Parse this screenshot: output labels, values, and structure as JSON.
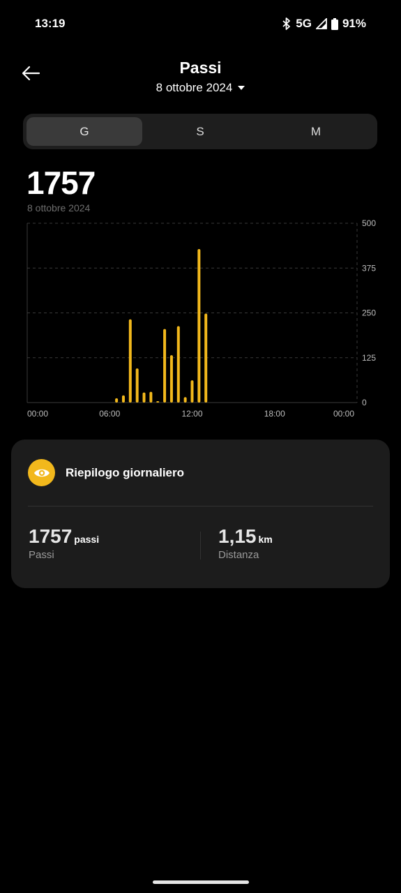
{
  "status_bar": {
    "time": "13:19",
    "network": "5G",
    "battery": "91%",
    "icons": [
      "bluetooth-icon",
      "signal-icon",
      "battery-icon"
    ]
  },
  "header": {
    "title": "Passi",
    "date": "8 ottobre 2024",
    "icons": [
      "back-arrow-icon",
      "dropdown-caret-icon"
    ]
  },
  "tabs": [
    {
      "label": "G",
      "active": true
    },
    {
      "label": "S",
      "active": false
    },
    {
      "label": "M",
      "active": false
    }
  ],
  "summary": {
    "total": "1757",
    "date": "8 ottobre 2024"
  },
  "chart_data": {
    "type": "bar",
    "title": "",
    "xlabel": "",
    "ylabel": "",
    "x_ticks": [
      "00:00",
      "06:00",
      "12:00",
      "18:00",
      "00:00"
    ],
    "y_ticks": [
      "500",
      "375",
      "250",
      "125",
      "0"
    ],
    "ylim": [
      0,
      500
    ],
    "y_axis_position": "right",
    "grid": true,
    "bar_color": "#f2b81c",
    "x_unit": "hour of day",
    "series": [
      {
        "x": [
          6.5,
          7.0,
          7.5,
          8.0,
          8.5,
          9.0,
          9.5,
          10.0,
          10.5,
          11.0,
          11.5,
          12.0,
          12.5,
          13.0
        ],
        "values": [
          12,
          20,
          232,
          95,
          28,
          30,
          4,
          205,
          132,
          213,
          15,
          62,
          428,
          248
        ]
      }
    ]
  },
  "daily_summary": {
    "title": "Riepilogo giornaliero",
    "icon": "eye-icon",
    "accent_color": "#f2b81c",
    "stats": [
      {
        "value": "1757",
        "unit": "passi",
        "label": "Passi"
      },
      {
        "value": "1,15",
        "unit": "km",
        "label": "Distanza"
      }
    ]
  }
}
